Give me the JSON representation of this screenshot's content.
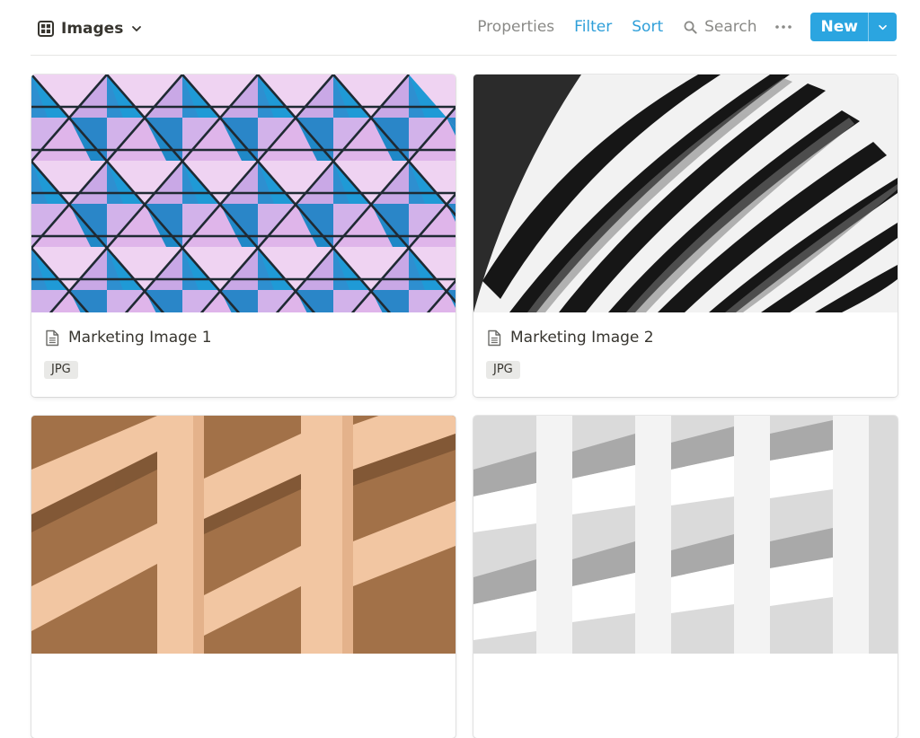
{
  "view": {
    "name": "Images",
    "icon": "gallery-view-icon"
  },
  "toolbar": {
    "properties": "Properties",
    "filter": "Filter",
    "sort": "Sort",
    "search": "Search",
    "new": "New"
  },
  "colors": {
    "accent": "#2ba5e0",
    "link": "#2f9fd9",
    "muted": "#8a8a87",
    "text": "#37352f",
    "tag_bg": "#e9e9e7"
  },
  "cards": [
    {
      "title": "Marketing Image 1",
      "tag": "JPG"
    },
    {
      "title": "Marketing Image 2",
      "tag": "JPG"
    },
    {
      "title": "",
      "tag": ""
    },
    {
      "title": "",
      "tag": ""
    }
  ]
}
